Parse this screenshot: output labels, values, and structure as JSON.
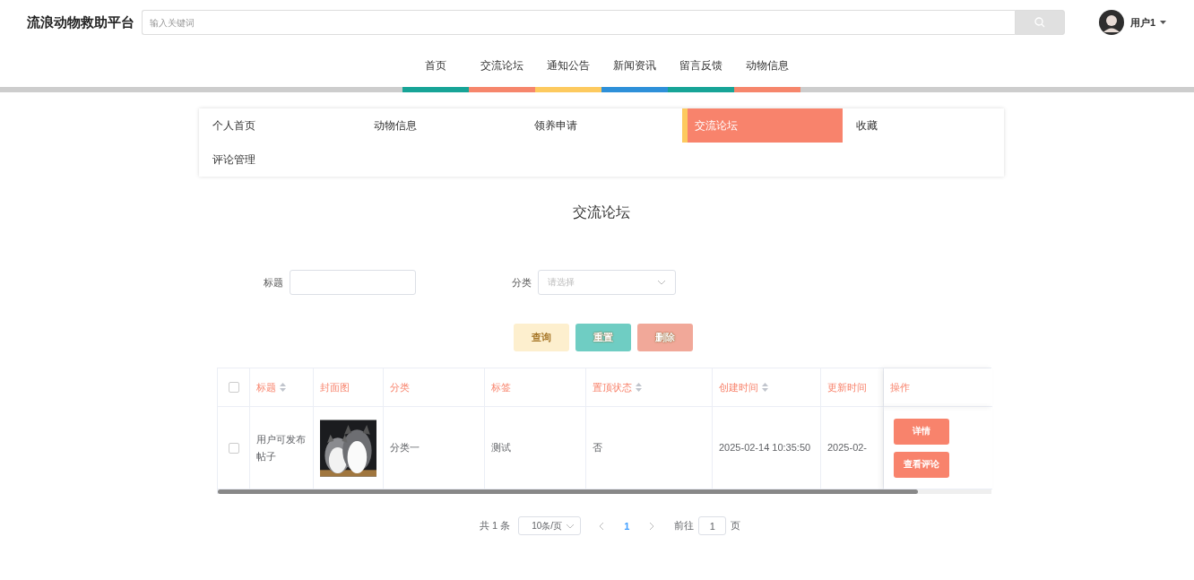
{
  "site_title": "流浪动物救助平台",
  "search": {
    "placeholder": "输入关键词"
  },
  "user": {
    "name": "用户1"
  },
  "nav": [
    {
      "label": "首页",
      "color": "#17a497"
    },
    {
      "label": "交流论坛",
      "color": "#f6866c"
    },
    {
      "label": "通知公告",
      "color": "#fdca5f"
    },
    {
      "label": "新闻资讯",
      "color": "#2e90d9"
    },
    {
      "label": "留言反馈",
      "color": "#17a497"
    },
    {
      "label": "动物信息",
      "color": "#f6866c"
    }
  ],
  "submenu": [
    {
      "label": "个人首页",
      "selected": false
    },
    {
      "label": "动物信息",
      "selected": false
    },
    {
      "label": "领养申请",
      "selected": false
    },
    {
      "label": "交流论坛",
      "selected": true
    },
    {
      "label": "收藏",
      "selected": false
    },
    {
      "label": "评论管理",
      "selected": false
    }
  ],
  "page_title": "交流论坛",
  "filters": [
    {
      "kind": "text",
      "label": "标题"
    },
    {
      "kind": "select",
      "label": "分类",
      "placeholder": "请选择"
    }
  ],
  "actions": [
    {
      "label": "查询",
      "color": "#fdefce"
    },
    {
      "label": "重置",
      "color": "#6fcdc3"
    },
    {
      "label": "删除",
      "color": "#f1a899"
    }
  ],
  "table": {
    "select_all": {
      "checked": false
    },
    "columns": [
      {
        "label": "标题",
        "sortable": true
      },
      {
        "label": "封面图",
        "sortable": false
      },
      {
        "label": "分类",
        "sortable": false
      },
      {
        "label": "标签",
        "sortable": false
      },
      {
        "label": "置顶状态",
        "sortable": true
      },
      {
        "label": "创建时间",
        "sortable": true
      },
      {
        "label": "更新时间",
        "sortable": false
      },
      {
        "label": "操作",
        "sortable": false
      }
    ],
    "rows": [
      {
        "checked": false,
        "title": "用户可发布帖子",
        "cover": {
          "kind": "picture"
        },
        "category": "分类一",
        "tag": "测试",
        "pinned": "否",
        "created": "2025-02-14 10:35:50",
        "updated": "2025-02-",
        "actions": [
          "详情",
          "查看评论"
        ]
      }
    ]
  },
  "pager": {
    "total": "共 1 条",
    "page_size": "10条/页",
    "pages": [
      {
        "label": "1",
        "selected": true
      }
    ],
    "goto_label": "前往",
    "goto_value": "1",
    "goto_suffix": "页"
  }
}
